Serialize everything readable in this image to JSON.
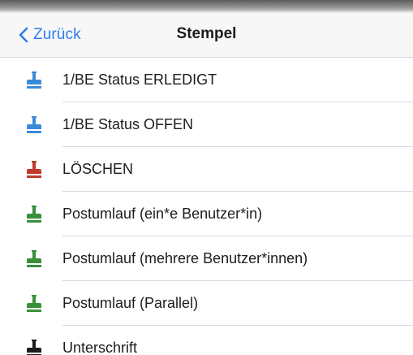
{
  "navbar": {
    "back_label": "Zurück",
    "title": "Stempel"
  },
  "stamps": [
    {
      "label": "1/BE Status ERLEDIGT",
      "icon": "stamp-icon",
      "color": "#3b8ad8"
    },
    {
      "label": "1/BE Status OFFEN",
      "icon": "stamp-icon",
      "color": "#3b8ad8"
    },
    {
      "label": "LÖSCHEN",
      "icon": "stamp-icon",
      "color": "#c0392b"
    },
    {
      "label": "Postumlauf (ein*e Benutzer*in)",
      "icon": "stamp-icon",
      "color": "#3a8f3a"
    },
    {
      "label": "Postumlauf (mehrere Benutzer*innen)",
      "icon": "stamp-icon",
      "color": "#3a8f3a"
    },
    {
      "label": "Postumlauf (Parallel)",
      "icon": "stamp-icon",
      "color": "#3a8f3a"
    },
    {
      "label": "Unterschrift",
      "icon": "stamp-icon",
      "color": "#1c1c1e"
    }
  ],
  "colors": {
    "accent": "#2f7cf0"
  }
}
